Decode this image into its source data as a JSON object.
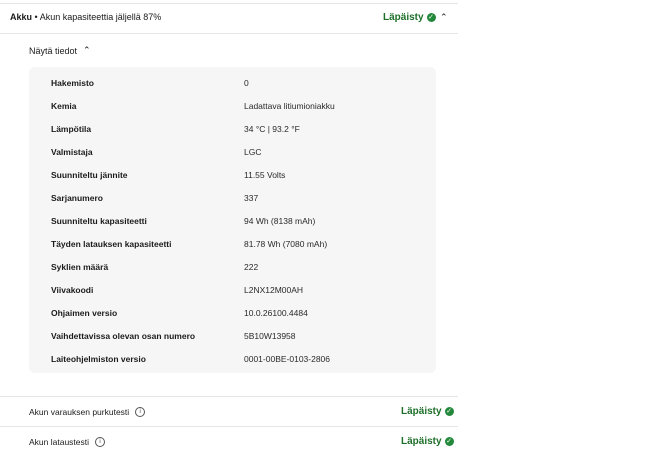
{
  "header": {
    "title": "Akku",
    "separator": "•",
    "summary": "Akun kapasiteettia jäljellä 87%",
    "status": "Läpäisty"
  },
  "details_toggle": "Näytä tiedot",
  "details": [
    {
      "label": "Hakemisto",
      "value": "0"
    },
    {
      "label": "Kemia",
      "value": "Ladattava litiumioniakku"
    },
    {
      "label": "Lämpötila",
      "value": "34 °C | 93.2 °F"
    },
    {
      "label": "Valmistaja",
      "value": "LGC"
    },
    {
      "label": "Suunniteltu jännite",
      "value": "11.55 Volts"
    },
    {
      "label": "Sarjanumero",
      "value": "337"
    },
    {
      "label": "Suunniteltu kapasiteetti",
      "value": "94 Wh (8138 mAh)"
    },
    {
      "label": "Täyden latauksen kapasiteetti",
      "value": "81.78 Wh (7080 mAh)"
    },
    {
      "label": "Syklien määrä",
      "value": "222"
    },
    {
      "label": "Viivakoodi",
      "value": "L2NX12M00AH"
    },
    {
      "label": "Ohjaimen versio",
      "value": "10.0.26100.4484"
    },
    {
      "label": "Vaihdettavissa olevan osan numero",
      "value": "5B10W13958"
    },
    {
      "label": "Laiteohjelmiston versio",
      "value": "0001-00BE-0103-2806"
    }
  ],
  "tests": [
    {
      "label": "Akun varauksen purkutesti",
      "status": "Läpäisty"
    },
    {
      "label": "Akun lataustesti",
      "status": "Läpäisty"
    }
  ],
  "icons": {
    "status": "check-circle-icon",
    "collapse": "chevron-up-icon",
    "info": "info-icon"
  },
  "colors": {
    "pass_green": "#23893a",
    "card_bg": "#f6f6f6"
  }
}
